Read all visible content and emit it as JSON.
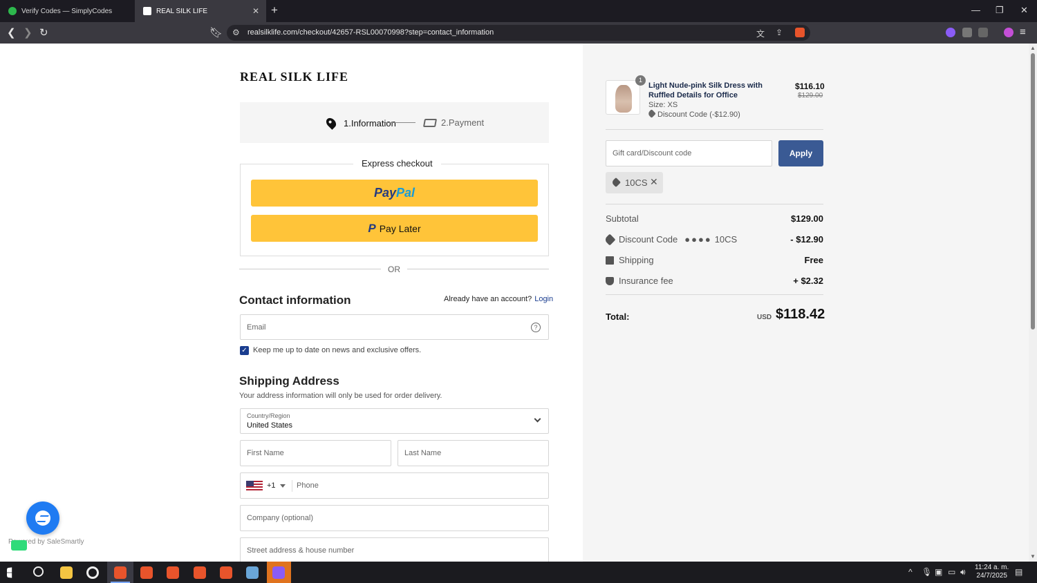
{
  "browser": {
    "tabs": [
      {
        "title": "Verify Codes — SimplyCodes"
      },
      {
        "title": "REAL SILK LIFE"
      }
    ],
    "url": "realsilklife.com/checkout/42657-RSL00070998?step=contact_information"
  },
  "checkout": {
    "brand": "REAL SILK LIFE",
    "steps": {
      "info": "1.Information",
      "payment": "2.Payment"
    },
    "express_title": "Express checkout",
    "paypal": {
      "pay": "Pay",
      "pal": "Pal"
    },
    "pay_later": "Pay Later",
    "or": "OR",
    "contact": {
      "title": "Contact information",
      "account_prompt": "Already have an account?",
      "login": "Login",
      "email_placeholder": "Email",
      "newsletter": "Keep me up to date on news and exclusive offers."
    },
    "shipping": {
      "title": "Shipping Address",
      "note": "Your address information will only be used for order delivery.",
      "country_label": "Country/Region",
      "country_value": "United States",
      "first_name": "First Name",
      "last_name": "Last Name",
      "dial_code": "+1",
      "phone": "Phone",
      "company": "Company (optional)",
      "street": "Street address & house number"
    },
    "widget": {
      "powered": "Powered by SaleSmartly"
    }
  },
  "summary": {
    "item": {
      "qty": "1",
      "name": "Light Nude-pink Silk Dress with Ruffled Details for Office",
      "size": "Size: XS",
      "discount": "Discount Code (-$12.90)",
      "price": "$116.10",
      "original_price": "$129.00"
    },
    "gift_placeholder": "Gift card/Discount code",
    "apply": "Apply",
    "applied_code": "10CS",
    "rows": {
      "subtotal_label": "Subtotal",
      "subtotal_value": "$129.00",
      "discount_label": "Discount Code",
      "discount_code": "10CS",
      "discount_value": "- $12.90",
      "shipping_label": "Shipping",
      "shipping_value": "Free",
      "insurance_label": "Insurance fee",
      "insurance_value": "+ $2.32"
    },
    "total": {
      "label": "Total:",
      "currency": "USD",
      "value": "$118.42"
    }
  },
  "taskbar": {
    "time": "11:24 a. m.",
    "date": "24/7/2025"
  },
  "colors": {
    "accent": "#1a3d8f",
    "apply": "#3a5a94",
    "paypal_yellow": "#ffc439"
  }
}
